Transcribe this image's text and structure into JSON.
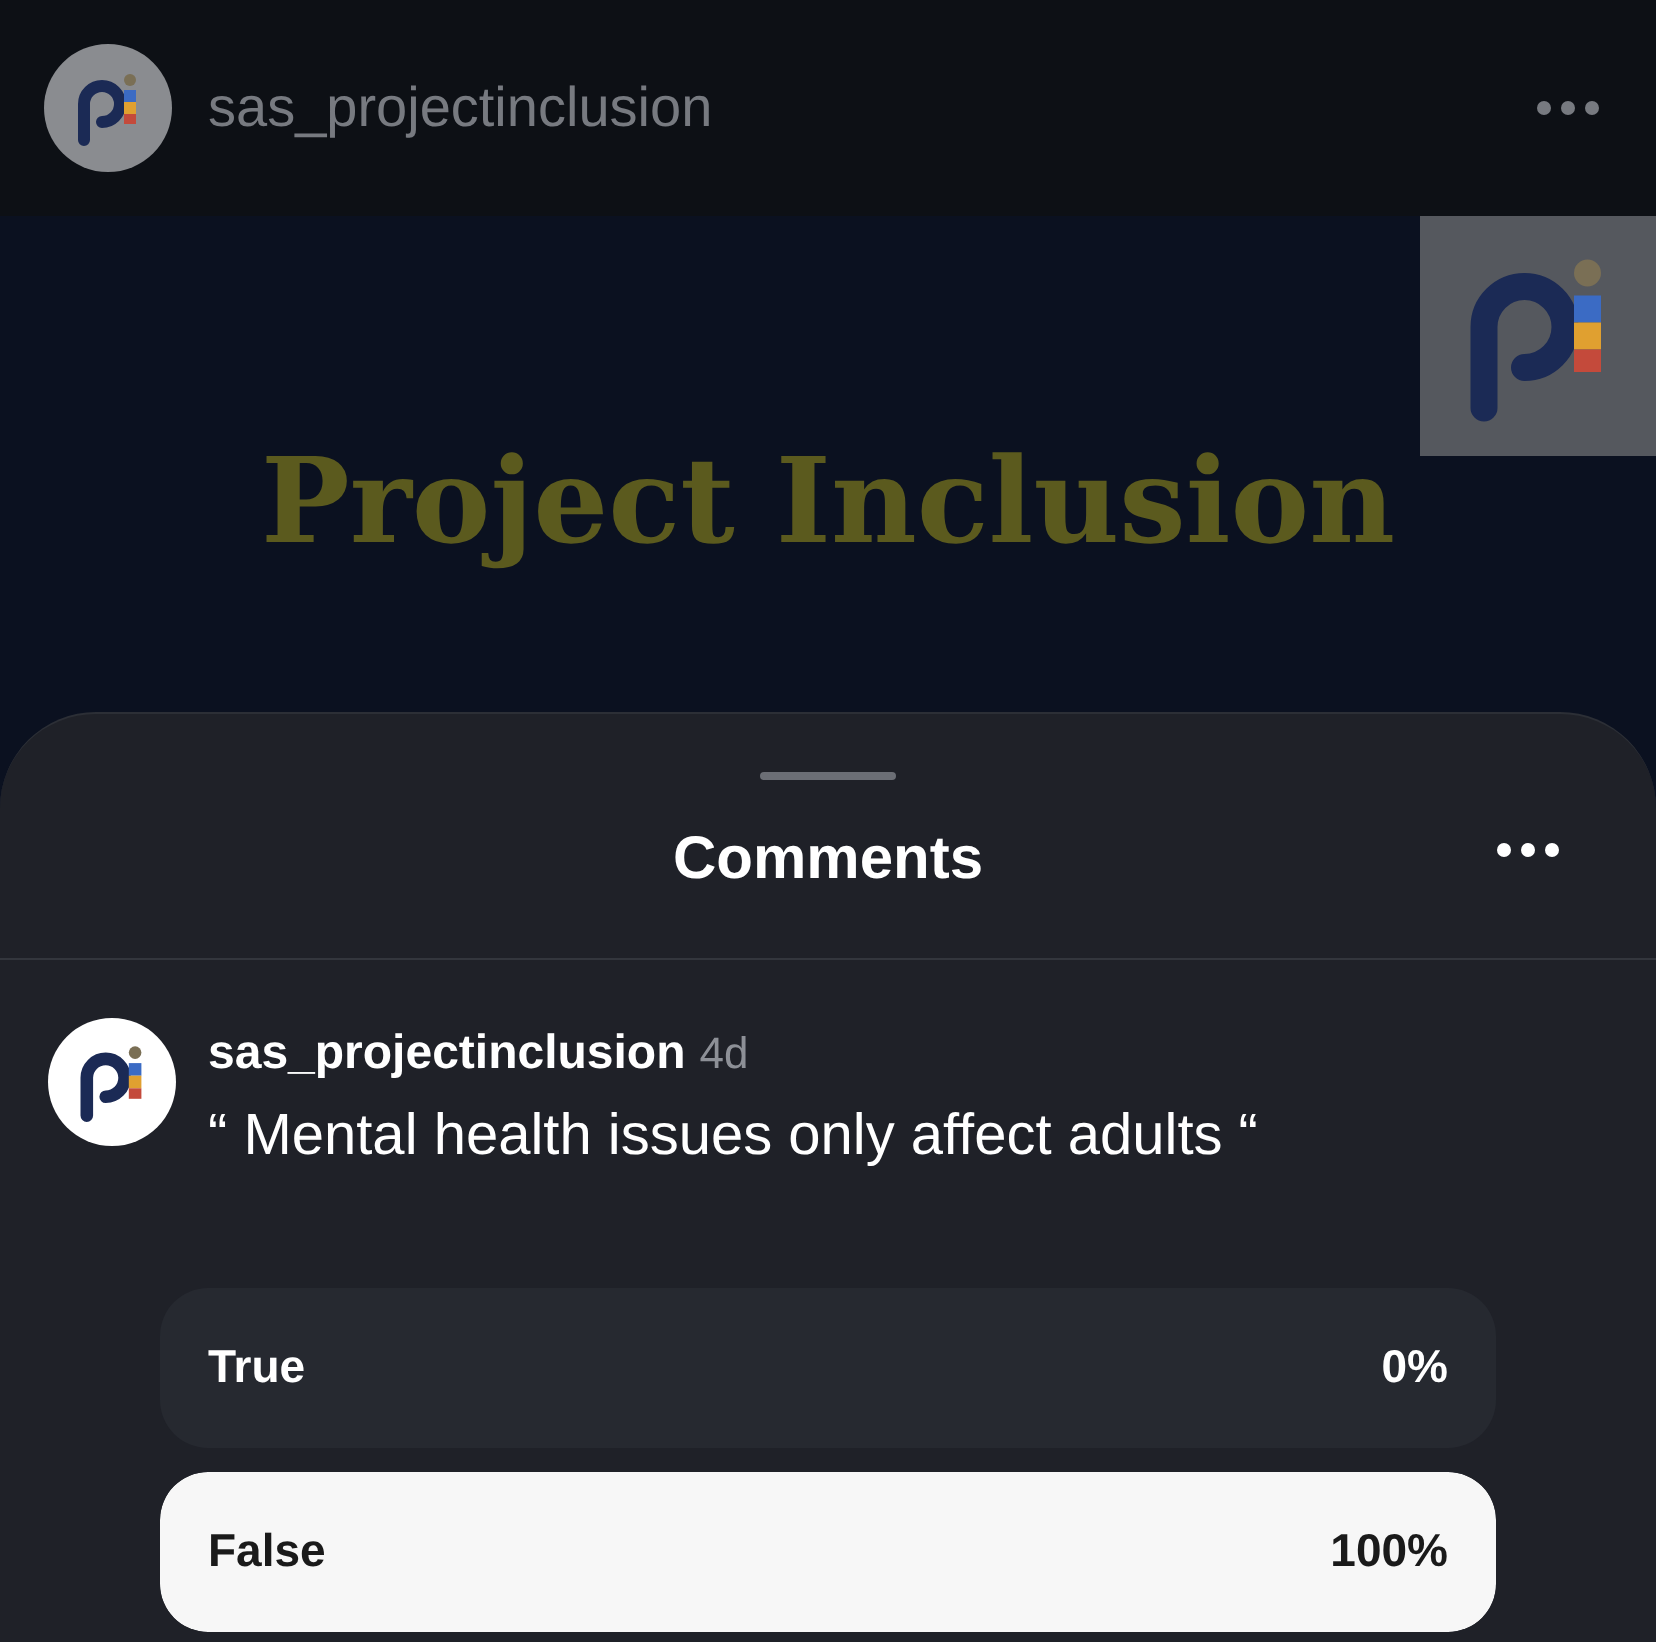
{
  "post_header": {
    "username": "sas_projectinclusion"
  },
  "post_image": {
    "title_lines": [
      "Project Inclusion"
    ]
  },
  "comments_sheet": {
    "title": "Comments"
  },
  "comment": {
    "username": "sas_projectinclusion",
    "time": "4d",
    "text": "“ Mental health issues only affect adults “"
  },
  "poll_options": [
    {
      "label": "True",
      "percent": "0%",
      "level": 0
    },
    {
      "label": "False",
      "percent": "100%",
      "level": 1
    }
  ]
}
